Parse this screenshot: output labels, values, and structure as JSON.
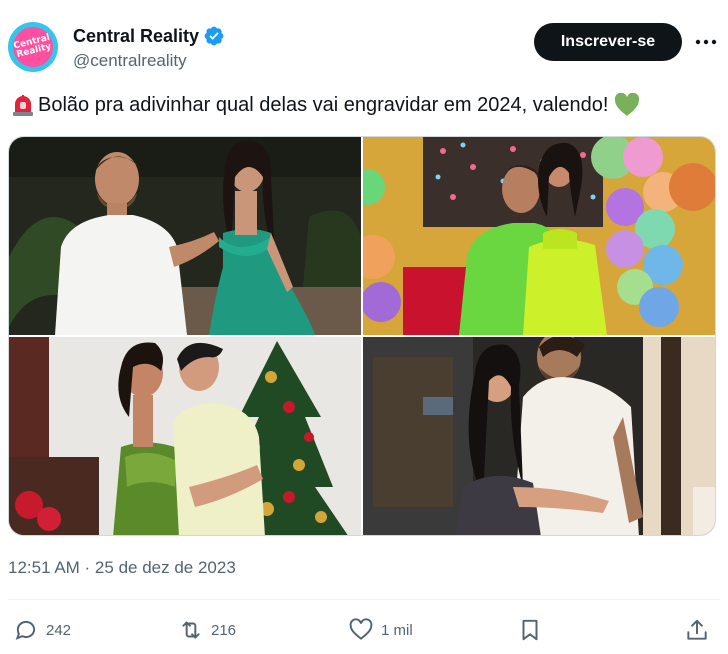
{
  "account": {
    "display_name": "Central Reality",
    "handle": "@centralreality",
    "avatar_text": "Central Reality",
    "avatar_colors": {
      "ring": "#35c4ea",
      "inner": "#ff4fa0"
    },
    "verified_color": "#1d9bf0"
  },
  "header": {
    "subscribe_label": "Inscrever-se",
    "more_icon": "more-horizontal-icon"
  },
  "tweet": {
    "leading_emoji": "siren-emoji",
    "text": "Bolão pra adivinhar qual delas vai engravidar em 2024, valendo!",
    "trailing_emoji": "green-heart-emoji",
    "timestamp": "12:51 AM · 25 de dez de 2023"
  },
  "media": {
    "photos": [
      {
        "icon": "couple-night-photo"
      },
      {
        "icon": "couple-balloons-photo"
      },
      {
        "icon": "couple-christmas-tree-photo"
      },
      {
        "icon": "couple-embrace-photo"
      }
    ]
  },
  "actions": {
    "replies": "242",
    "reposts": "216",
    "likes": "1 mil",
    "bookmark_icon": "bookmark-icon",
    "share_icon": "share-icon"
  },
  "colors": {
    "text": "#0f1419",
    "secondary": "#536471",
    "button_bg": "#0f1419",
    "border": "#cfd9de"
  }
}
